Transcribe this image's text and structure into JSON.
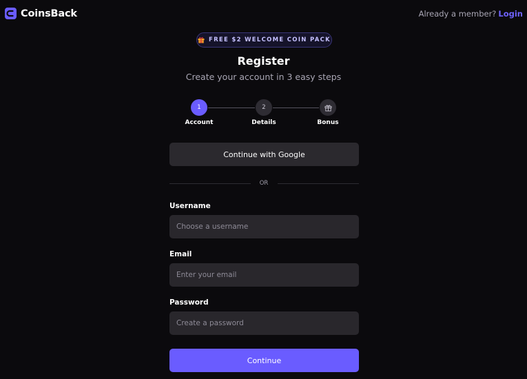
{
  "header": {
    "brand": "CoinsBack",
    "member_prompt": "Already a member?",
    "login_label": "Login"
  },
  "badge": {
    "text": "FREE $2 WELCOME COIN PACK",
    "icon": "gift-icon"
  },
  "title": "Register",
  "subtitle": "Create your account in 3 easy steps",
  "steps": [
    {
      "number": "1",
      "label": "Account",
      "state": "active"
    },
    {
      "number": "2",
      "label": "Details",
      "state": "inactive"
    },
    {
      "icon": "gift-icon",
      "label": "Bonus",
      "state": "inactive"
    }
  ],
  "google_button": "Continue with Google",
  "divider_text": "OR",
  "fields": {
    "username": {
      "label": "Username",
      "placeholder": "Choose a username",
      "value": ""
    },
    "email": {
      "label": "Email",
      "placeholder": "Enter your email",
      "value": ""
    },
    "password": {
      "label": "Password",
      "placeholder": "Create a password",
      "value": ""
    }
  },
  "continue_button": "Continue",
  "colors": {
    "accent": "#6a5cff",
    "background": "#0b0a0d",
    "surface": "#29272c",
    "muted_text": "#a9a6b4"
  }
}
